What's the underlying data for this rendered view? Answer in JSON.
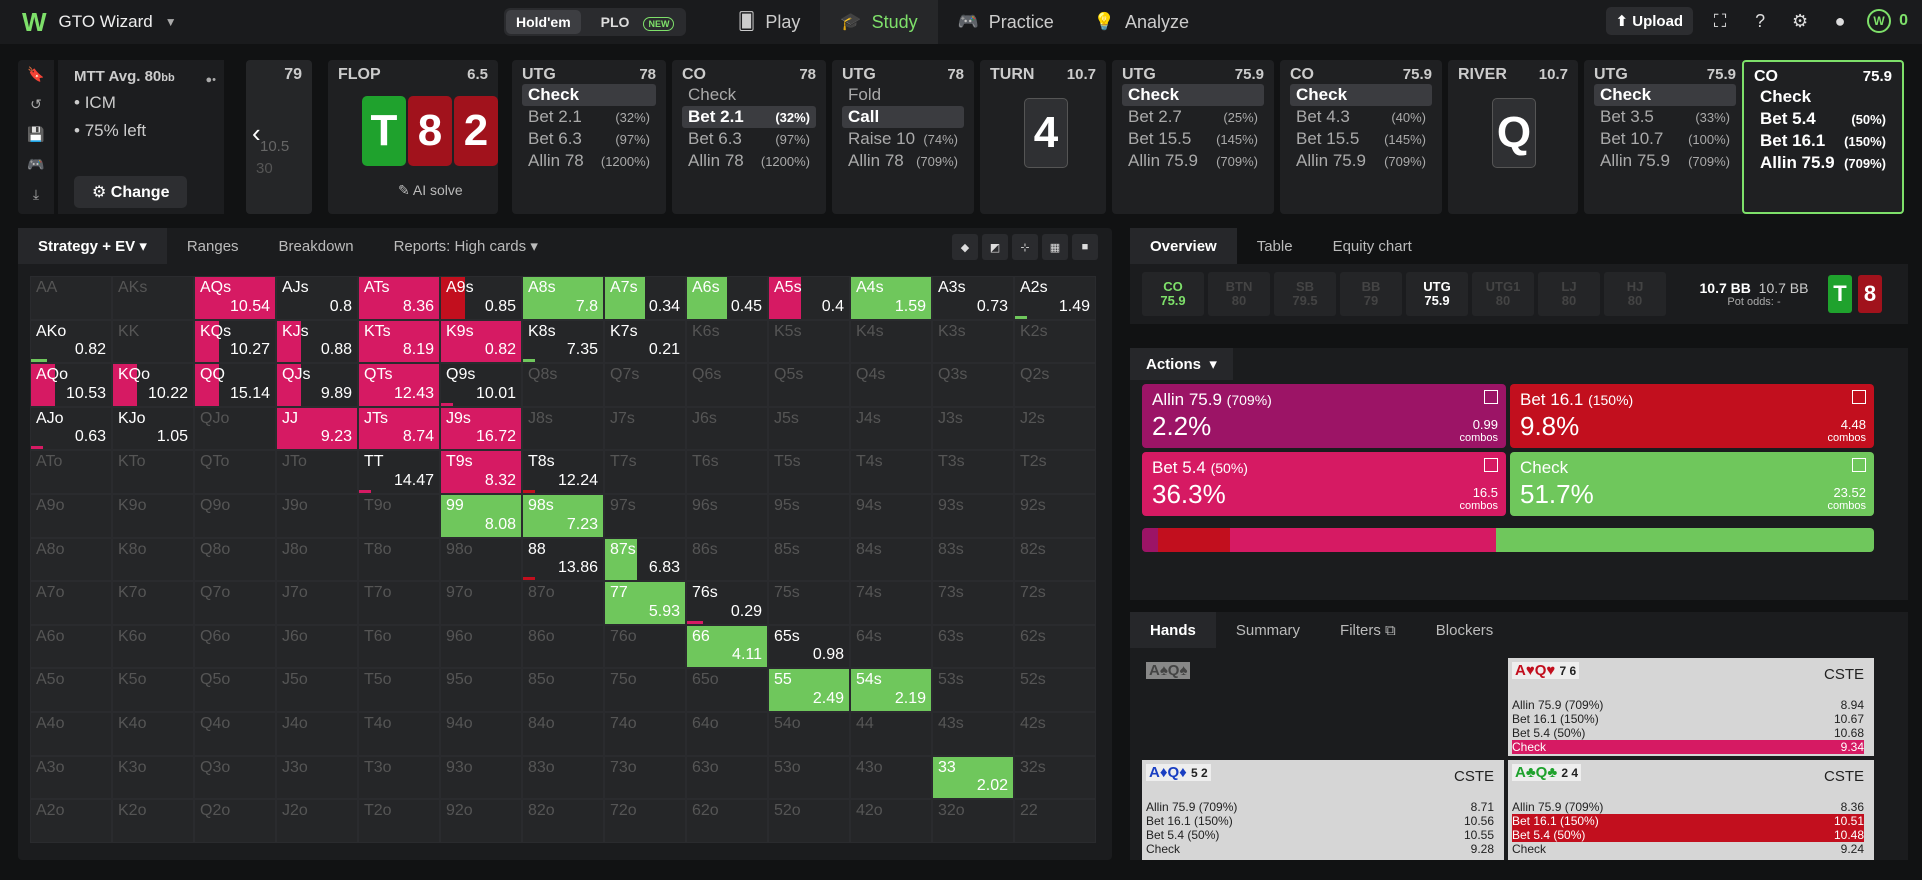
{
  "app": {
    "name": "GTO Wizard"
  },
  "game_toggle": {
    "holdem": "Hold'em",
    "plo": "PLO",
    "new_badge": "NEW"
  },
  "nav": {
    "play": "Play",
    "study": "Study",
    "practice": "Practice",
    "analyze": "Analyze"
  },
  "top_right": {
    "upload": "Upload",
    "coins": "0"
  },
  "mtt": {
    "title": "MTT",
    "avg": "Avg. 80",
    "bb": "bb",
    "icm": "ICM",
    "left": "75% left",
    "change": "Change"
  },
  "prev_node": {
    "amount": "79",
    "val1": "10.5",
    "val2": "30"
  },
  "flop": {
    "label": "FLOP",
    "pot": "6.5",
    "cards": [
      "T",
      "8",
      "2"
    ],
    "ai": "AI solve"
  },
  "nodes": [
    {
      "pos": "UTG",
      "stack": "78",
      "rows": [
        [
          "Check",
          ""
        ],
        [
          "Bet 2.1",
          "(32%)"
        ],
        [
          "Bet 6.3",
          "(97%)"
        ],
        [
          "Allin 78",
          "(1200%)"
        ]
      ]
    },
    {
      "pos": "CO",
      "stack": "78",
      "rows": [
        [
          "Check",
          ""
        ],
        [
          "Bet 2.1",
          "(32%)"
        ],
        [
          "Bet 6.3",
          "(97%)"
        ],
        [
          "Allin 78",
          "(1200%)"
        ]
      ]
    },
    {
      "pos": "UTG",
      "stack": "78",
      "rows": [
        [
          "Fold",
          ""
        ],
        [
          "Call",
          ""
        ],
        [
          "Raise 10",
          "(74%)"
        ],
        [
          "Allin 78",
          "(709%)"
        ]
      ]
    },
    {
      "pos": "UTG",
      "stack": "75.9",
      "rows": [
        [
          "Check",
          ""
        ],
        [
          "Bet 2.7",
          "(25%)"
        ],
        [
          "Bet 15.5",
          "(145%)"
        ],
        [
          "Allin 75.9",
          "(709%)"
        ]
      ]
    },
    {
      "pos": "CO",
      "stack": "75.9",
      "rows": [
        [
          "Check",
          ""
        ],
        [
          "Bet 4.3",
          "(40%)"
        ],
        [
          "Bet 15.5",
          "(145%)"
        ],
        [
          "Allin 75.9",
          "(709%)"
        ]
      ]
    },
    {
      "pos": "UTG",
      "stack": "75.9",
      "rows": [
        [
          "Check",
          ""
        ],
        [
          "Bet 3.5",
          "(33%)"
        ],
        [
          "Bet 10.7",
          "(100%)"
        ],
        [
          "Allin 75.9",
          "(709%)"
        ]
      ]
    },
    {
      "pos": "CO",
      "stack": "75.9",
      "rows": [
        [
          "Check",
          ""
        ],
        [
          "Bet 5.4",
          "(50%)"
        ],
        [
          "Bet 16.1",
          "(150%)"
        ],
        [
          "Allin 75.9",
          "(709%)"
        ]
      ]
    }
  ],
  "turn": {
    "label": "TURN",
    "pot": "10.7",
    "card": "4"
  },
  "river": {
    "label": "RIVER",
    "pot": "10.7",
    "card": "Q"
  },
  "left_tabs": {
    "strategy": "Strategy + EV",
    "ranges": "Ranges",
    "breakdown": "Breakdown",
    "reports": "Reports: High cards"
  },
  "grid": [
    [
      "AA",
      "",
      "",
      ""
    ],
    [
      "AKs",
      "",
      "",
      ""
    ],
    [
      "AQs",
      "10.54",
      "p",
      "0.9"
    ],
    [
      "AJs",
      "0.8",
      "",
      "0"
    ],
    [
      "ATs",
      "8.36",
      "p",
      "1"
    ],
    [
      "A9s",
      "0.85",
      "r",
      "0.3"
    ],
    [
      "A8s",
      "7.8",
      "g",
      "1"
    ],
    [
      "A7s",
      "0.34",
      "g",
      "0.5"
    ],
    [
      "A6s",
      "0.45",
      "g",
      "0.5"
    ],
    [
      "A5s",
      "0.4",
      "p",
      "0.4"
    ],
    [
      "A4s",
      "1.59",
      "g",
      "0.9"
    ],
    [
      "A3s",
      "0.73",
      "",
      "0"
    ],
    [
      "A2s",
      "1.49",
      "g",
      "0.08"
    ],
    [
      "AKo",
      "0.82",
      "g",
      "0.2"
    ],
    [
      "KK",
      "",
      "",
      ""
    ],
    [
      "KQs",
      "10.27",
      "p",
      "0.3"
    ],
    [
      "KJs",
      "0.88",
      "p",
      "0.3"
    ],
    [
      "KTs",
      "8.19",
      "p",
      "1"
    ],
    [
      "K9s",
      "0.82",
      "p",
      "1"
    ],
    [
      "K8s",
      "7.35",
      "g",
      "0.05"
    ],
    [
      "K7s",
      "0.21",
      "",
      "0"
    ],
    [
      "K6s",
      "",
      "",
      ""
    ],
    [
      "K5s",
      "",
      "",
      ""
    ],
    [
      "K4s",
      "",
      "",
      ""
    ],
    [
      "K3s",
      "",
      "",
      ""
    ],
    [
      "K2s",
      "",
      "",
      ""
    ],
    [
      "AQo",
      "10.53",
      "p",
      "0.3"
    ],
    [
      "KQo",
      "10.22",
      "p",
      "0.3"
    ],
    [
      "QQ",
      "15.14",
      "p",
      "0.3"
    ],
    [
      "QJs",
      "9.89",
      "p",
      "0.3"
    ],
    [
      "QTs",
      "12.43",
      "p",
      "1"
    ],
    [
      "Q9s",
      "10.01",
      "p",
      "0.1"
    ],
    [
      "Q8s",
      "",
      "",
      ""
    ],
    [
      "Q7s",
      "",
      "",
      ""
    ],
    [
      "Q6s",
      "",
      "",
      ""
    ],
    [
      "Q5s",
      "",
      "",
      ""
    ],
    [
      "Q4s",
      "",
      "",
      ""
    ],
    [
      "Q3s",
      "",
      "",
      ""
    ],
    [
      "Q2s",
      "",
      "",
      ""
    ],
    [
      "AJo",
      "0.63",
      "p",
      "0.1"
    ],
    [
      "KJo",
      "1.05",
      "",
      "0"
    ],
    [
      "QJo",
      "",
      "",
      ""
    ],
    [
      "JJ",
      "9.23",
      "p",
      "1"
    ],
    [
      "JTs",
      "8.74",
      "p",
      "1"
    ],
    [
      "J9s",
      "16.72",
      "p",
      "1"
    ],
    [
      "J8s",
      "",
      "",
      ""
    ],
    [
      "J7s",
      "",
      "",
      ""
    ],
    [
      "J6s",
      "",
      "",
      ""
    ],
    [
      "J5s",
      "",
      "",
      ""
    ],
    [
      "J4s",
      "",
      "",
      ""
    ],
    [
      "J3s",
      "",
      "",
      ""
    ],
    [
      "J2s",
      "",
      "",
      ""
    ],
    [
      "ATo",
      "",
      "",
      ""
    ],
    [
      "KTo",
      "",
      "",
      ""
    ],
    [
      "QTo",
      "",
      "",
      ""
    ],
    [
      "JTo",
      "",
      "",
      ""
    ],
    [
      "TT",
      "14.47",
      "p",
      "0.15"
    ],
    [
      "T9s",
      "8.32",
      "p",
      "1"
    ],
    [
      "T8s",
      "12.24",
      "r",
      "0.1"
    ],
    [
      "T7s",
      "",
      "",
      ""
    ],
    [
      "T6s",
      "",
      "",
      ""
    ],
    [
      "T5s",
      "",
      "",
      ""
    ],
    [
      "T4s",
      "",
      "",
      ""
    ],
    [
      "T3s",
      "",
      "",
      ""
    ],
    [
      "T2s",
      "",
      "",
      ""
    ],
    [
      "A9o",
      "",
      "",
      ""
    ],
    [
      "K9o",
      "",
      "",
      ""
    ],
    [
      "Q9o",
      "",
      "",
      ""
    ],
    [
      "J9o",
      "",
      "",
      ""
    ],
    [
      "T9o",
      "",
      "",
      ""
    ],
    [
      "99",
      "8.08",
      "g",
      "1"
    ],
    [
      "98s",
      "7.23",
      "g",
      "1"
    ],
    [
      "97s",
      "",
      "",
      ""
    ],
    [
      "96s",
      "",
      "",
      ""
    ],
    [
      "95s",
      "",
      "",
      ""
    ],
    [
      "94s",
      "",
      "",
      ""
    ],
    [
      "93s",
      "",
      "",
      ""
    ],
    [
      "92s",
      "",
      "",
      ""
    ],
    [
      "A8o",
      "",
      "",
      ""
    ],
    [
      "K8o",
      "",
      "",
      ""
    ],
    [
      "Q8o",
      "",
      "",
      ""
    ],
    [
      "J8o",
      "",
      "",
      ""
    ],
    [
      "T8o",
      "",
      "",
      ""
    ],
    [
      "98o",
      "",
      "",
      ""
    ],
    [
      "88",
      "13.86",
      "r",
      "0.1"
    ],
    [
      "87s",
      "6.83",
      "g",
      "0.4"
    ],
    [
      "86s",
      "",
      "",
      ""
    ],
    [
      "85s",
      "",
      "",
      ""
    ],
    [
      "84s",
      "",
      "",
      ""
    ],
    [
      "83s",
      "",
      "",
      ""
    ],
    [
      "82s",
      "",
      "",
      ""
    ],
    [
      "A7o",
      "",
      "",
      ""
    ],
    [
      "K7o",
      "",
      "",
      ""
    ],
    [
      "Q7o",
      "",
      "",
      ""
    ],
    [
      "J7o",
      "",
      "",
      ""
    ],
    [
      "T7o",
      "",
      "",
      ""
    ],
    [
      "97o",
      "",
      "",
      ""
    ],
    [
      "87o",
      "",
      "",
      ""
    ],
    [
      "77",
      "5.93",
      "g",
      "1"
    ],
    [
      "76s",
      "0.29",
      "p",
      "0.2"
    ],
    [
      "75s",
      "",
      "",
      ""
    ],
    [
      "74s",
      "",
      "",
      ""
    ],
    [
      "73s",
      "",
      "",
      ""
    ],
    [
      "72s",
      "",
      "",
      ""
    ],
    [
      "A6o",
      "",
      "",
      ""
    ],
    [
      "K6o",
      "",
      "",
      ""
    ],
    [
      "Q6o",
      "",
      "",
      ""
    ],
    [
      "J6o",
      "",
      "",
      ""
    ],
    [
      "T6o",
      "",
      "",
      ""
    ],
    [
      "96o",
      "",
      "",
      ""
    ],
    [
      "86o",
      "",
      "",
      ""
    ],
    [
      "76o",
      "",
      "",
      ""
    ],
    [
      "66",
      "4.11",
      "g",
      "1"
    ],
    [
      "65s",
      "0.98",
      "",
      "0"
    ],
    [
      "64s",
      "",
      "",
      ""
    ],
    [
      "63s",
      "",
      "",
      ""
    ],
    [
      "62s",
      "",
      "",
      ""
    ],
    [
      "A5o",
      "",
      "",
      ""
    ],
    [
      "K5o",
      "",
      "",
      ""
    ],
    [
      "Q5o",
      "",
      "",
      ""
    ],
    [
      "J5o",
      "",
      "",
      ""
    ],
    [
      "T5o",
      "",
      "",
      ""
    ],
    [
      "95o",
      "",
      "",
      ""
    ],
    [
      "85o",
      "",
      "",
      ""
    ],
    [
      "75o",
      "",
      "",
      ""
    ],
    [
      "65o",
      "",
      "",
      ""
    ],
    [
      "55",
      "2.49",
      "g",
      "1"
    ],
    [
      "54s",
      "2.19",
      "g",
      "1"
    ],
    [
      "53s",
      "",
      "",
      ""
    ],
    [
      "52s",
      "",
      "",
      ""
    ],
    [
      "A4o",
      "",
      "",
      ""
    ],
    [
      "K4o",
      "",
      "",
      ""
    ],
    [
      "Q4o",
      "",
      "",
      ""
    ],
    [
      "J4o",
      "",
      "",
      ""
    ],
    [
      "T4o",
      "",
      "",
      ""
    ],
    [
      "94o",
      "",
      "",
      ""
    ],
    [
      "84o",
      "",
      "",
      ""
    ],
    [
      "74o",
      "",
      "",
      ""
    ],
    [
      "64o",
      "",
      "",
      ""
    ],
    [
      "54o",
      "",
      "",
      ""
    ],
    [
      "44",
      "",
      "",
      ""
    ],
    [
      "43s",
      "",
      "",
      ""
    ],
    [
      "42s",
      "",
      "",
      ""
    ],
    [
      "A3o",
      "",
      "",
      ""
    ],
    [
      "K3o",
      "",
      "",
      ""
    ],
    [
      "Q3o",
      "",
      "",
      ""
    ],
    [
      "J3o",
      "",
      "",
      ""
    ],
    [
      "T3o",
      "",
      "",
      ""
    ],
    [
      "93o",
      "",
      "",
      ""
    ],
    [
      "83o",
      "",
      "",
      ""
    ],
    [
      "73o",
      "",
      "",
      ""
    ],
    [
      "63o",
      "",
      "",
      ""
    ],
    [
      "53o",
      "",
      "",
      ""
    ],
    [
      "43o",
      "",
      "",
      ""
    ],
    [
      "33",
      "2.02",
      "g",
      "1"
    ],
    [
      "32s",
      "",
      "",
      ""
    ],
    [
      "A2o",
      "",
      "",
      ""
    ],
    [
      "K2o",
      "",
      "",
      ""
    ],
    [
      "Q2o",
      "",
      "",
      ""
    ],
    [
      "J2o",
      "",
      "",
      ""
    ],
    [
      "T2o",
      "",
      "",
      ""
    ],
    [
      "92o",
      "",
      "",
      ""
    ],
    [
      "82o",
      "",
      "",
      ""
    ],
    [
      "72o",
      "",
      "",
      ""
    ],
    [
      "62o",
      "",
      "",
      ""
    ],
    [
      "52o",
      "",
      "",
      ""
    ],
    [
      "42o",
      "",
      "",
      ""
    ],
    [
      "32o",
      "",
      "",
      ""
    ],
    [
      "22",
      "",
      "",
      ""
    ]
  ],
  "right_tabs": {
    "overview": "Overview",
    "table": "Table",
    "equity": "Equity chart"
  },
  "seats": [
    {
      "name": "CO",
      "stack": "75.9"
    },
    {
      "name": "BTN",
      "stack": "80"
    },
    {
      "name": "SB",
      "stack": "79.5"
    },
    {
      "name": "BB",
      "stack": "79"
    },
    {
      "name": "UTG",
      "stack": "75.9"
    },
    {
      "name": "UTG1",
      "stack": "80"
    },
    {
      "name": "LJ",
      "stack": "80"
    },
    {
      "name": "HJ",
      "stack": "80"
    }
  ],
  "pot": {
    "a": "10.7 BB",
    "b": "10.7 BB",
    "odds": "Pot odds:",
    "odds_val": "-"
  },
  "actions": {
    "label": "Actions",
    "allin": {
      "name": "Allin 75.9",
      "pct_note": "(709%)",
      "freq": "2.2%",
      "combos": "0.99",
      "unit": "combos"
    },
    "bet161": {
      "name": "Bet 16.1",
      "pct_note": "(150%)",
      "freq": "9.8%",
      "combos": "4.48",
      "unit": "combos"
    },
    "bet54": {
      "name": "Bet 5.4",
      "pct_note": "(50%)",
      "freq": "36.3%",
      "combos": "16.5",
      "unit": "combos"
    },
    "check": {
      "name": "Check",
      "pct_note": "",
      "freq": "51.7%",
      "combos": "23.52",
      "unit": "combos"
    }
  },
  "colors": {
    "allin": "#9c1466",
    "bet161": "#c20f1e",
    "bet54": "#d61a63",
    "check": "#6fc75c"
  },
  "hands_tabs": {
    "hands": "Hands",
    "summary": "Summary",
    "filters": "Filters",
    "blockers": "Blockers"
  },
  "hand_cards": [
    {
      "name": "A♠Q♠",
      "stage": "",
      "rows": []
    },
    {
      "name": "A♥Q♥",
      "b1": "7",
      "b2": "6",
      "stage": "CSTE",
      "rows": [
        [
          "Allin 75.9 (709%)",
          "8.94"
        ],
        [
          "Bet 16.1 (150%)",
          "10.67"
        ],
        [
          "Bet 5.4 (50%)",
          "10.68"
        ],
        [
          "Check",
          "9.34"
        ]
      ]
    },
    {
      "name": "A♦Q♦",
      "b1": "5",
      "b2": "2",
      "stage": "CSTE",
      "rows": [
        [
          "Allin 75.9 (709%)",
          "8.71"
        ],
        [
          "Bet 16.1 (150%)",
          "10.56"
        ],
        [
          "Bet 5.4 (50%)",
          "10.55"
        ],
        [
          "Check",
          "9.28"
        ]
      ]
    },
    {
      "name": "A♣Q♣",
      "b1": "2",
      "b2": "4",
      "stage": "CSTE",
      "rows": [
        [
          "Allin 75.9 (709%)",
          "8.36"
        ],
        [
          "Bet 16.1 (150%)",
          "10.51"
        ],
        [
          "Bet 5.4 (50%)",
          "10.48"
        ],
        [
          "Check",
          "9.24"
        ]
      ]
    }
  ]
}
